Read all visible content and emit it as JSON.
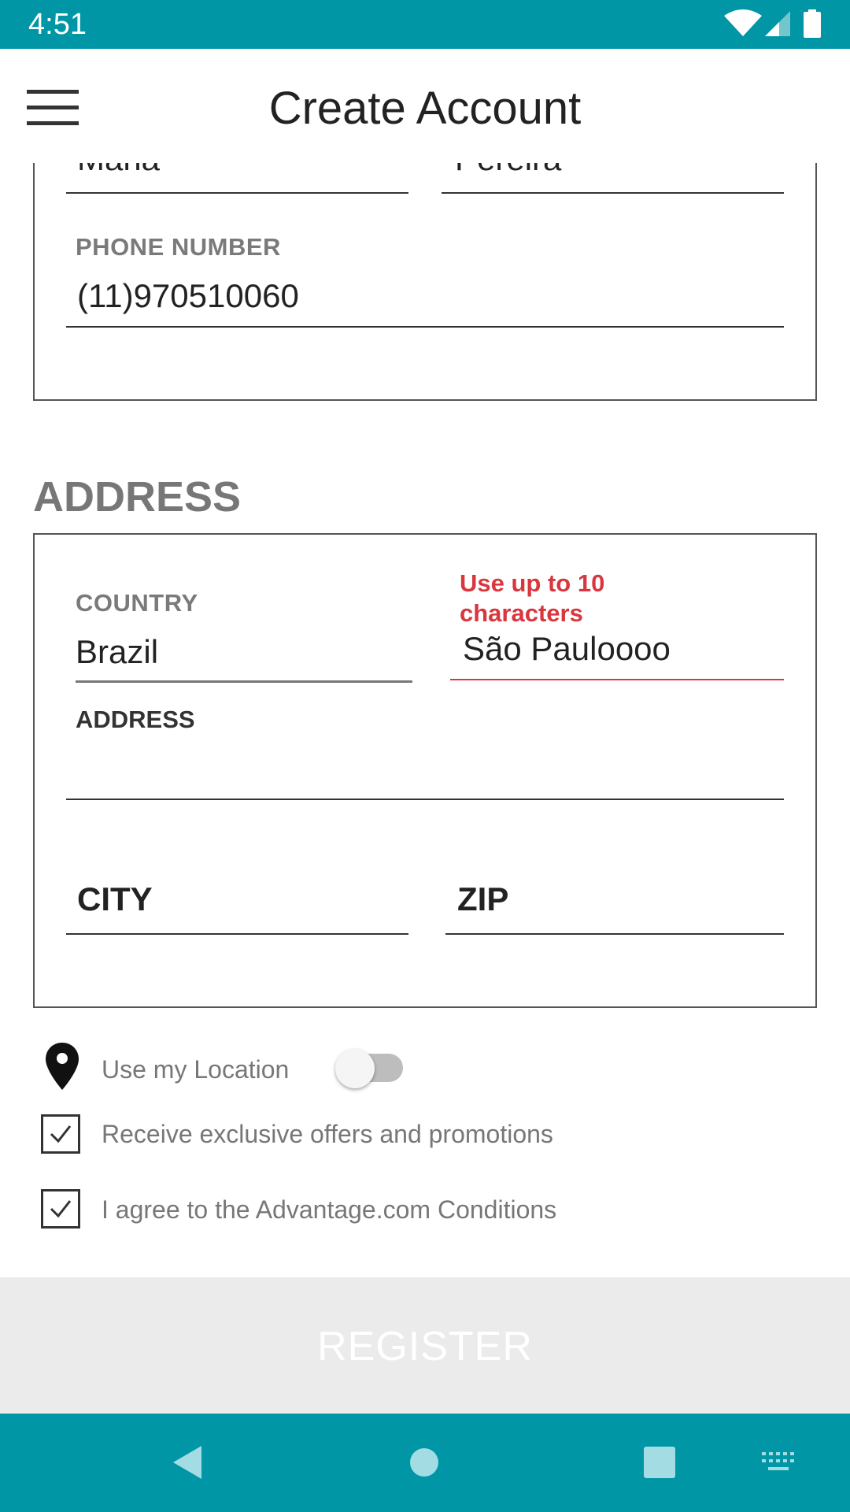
{
  "status_bar": {
    "time": "4:51"
  },
  "app_bar": {
    "title": "Create Account",
    "menu_icon": "hamburger-menu-icon"
  },
  "personal": {
    "first_name_value": "Maria",
    "last_name_value": "Pereira",
    "phone_label": "PHONE NUMBER",
    "phone_value": "(11)970510060"
  },
  "address_section": {
    "title": "ADDRESS",
    "country_label": "COUNTRY",
    "country_value": "Brazil",
    "state_error": "Use up to 10 characters",
    "state_error_line1": "Use up to 10",
    "state_error_line2": "characters",
    "state_value": "São Pauloooo",
    "address_label": "ADDRESS",
    "address_value": "",
    "city_placeholder": "CITY",
    "zip_placeholder": "ZIP"
  },
  "options": {
    "use_location_label": "Use my Location",
    "use_location_on": false,
    "offers_label": "Receive exclusive offers and promotions",
    "offers_checked": true,
    "conditions_label": "I agree to the Advantage.com Conditions",
    "conditions_checked": true
  },
  "register": {
    "label": "REGISTER"
  },
  "colors": {
    "primary": "#0096a6",
    "error": "#d9363e",
    "register_bg": "#ebebeb"
  }
}
